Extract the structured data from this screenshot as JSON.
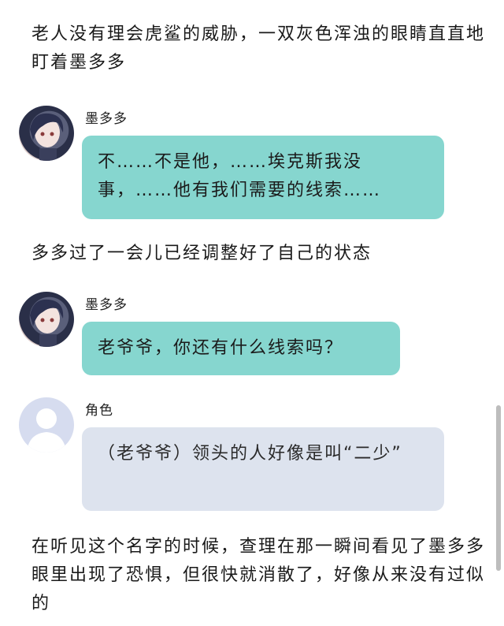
{
  "narration": {
    "p1": "老人没有理会虎鲨的威胁，一双灰色浑浊的眼睛直直地盯着墨多多",
    "p2": "多多过了一会儿已经调整好了自己的状态",
    "p3": "在听见这个名字的时候，查理在那一瞬间看见了墨多多眼里出现了恐惧，但很快就消散了，好像从来没有过似的"
  },
  "messages": [
    {
      "sender": "墨多多",
      "text": "不……不是他，……埃克斯我没事，……他有我们需要的线索……",
      "avatar": "anime-avatar",
      "color": "#86d6cf"
    },
    {
      "sender": "墨多多",
      "text": "老爷爷，你还有什么线索吗？",
      "avatar": "anime-avatar",
      "color": "#86d6cf"
    },
    {
      "sender": "角色",
      "text": "（老爷爷）领头的人好像是叫“二少”",
      "avatar": "default-user-icon",
      "color": "#dde3ee"
    }
  ]
}
